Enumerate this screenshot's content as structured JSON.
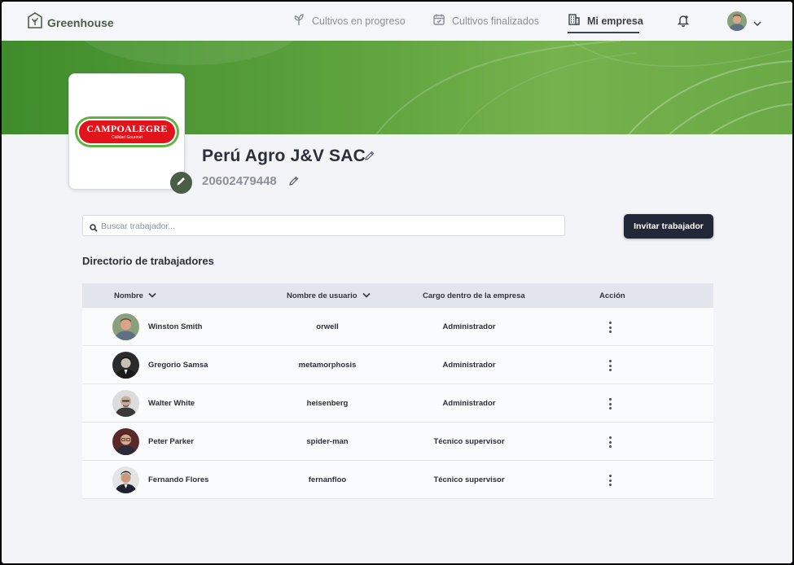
{
  "app": {
    "name": "Greenhouse"
  },
  "nav": {
    "items": [
      {
        "label": "Cultivos en progreso",
        "icon": "sprout-icon"
      },
      {
        "label": "Cultivos finalizados",
        "icon": "calendar-check-icon"
      },
      {
        "label": "Mi empresa",
        "icon": "building-icon",
        "active": true
      }
    ]
  },
  "company": {
    "logo_text": "CAMPOALEGRE",
    "logo_subtext": "Calidad Gourmet",
    "name": "Perú Agro J&V SAC",
    "ruc": "20602479448"
  },
  "search": {
    "placeholder": "Buscar trabajador..."
  },
  "invite_label": "Invitar trabajador",
  "directory": {
    "title": "Directorio de trabajadores",
    "columns": [
      "Nombre",
      "Nombre de usuario",
      "Cargo dentro de la empresa",
      "Acción"
    ],
    "rows": [
      {
        "name": "Winston Smith",
        "username": "orwell",
        "role": "Administrador"
      },
      {
        "name": "Gregorio Samsa",
        "username": "metamorphosis",
        "role": "Administrador"
      },
      {
        "name": "Walter White",
        "username": "heisenberg",
        "role": "Administrador"
      },
      {
        "name": "Peter Parker",
        "username": "spider-man",
        "role": "Técnico supervisor"
      },
      {
        "name": "Fernando Flores",
        "username": "fernanfloo",
        "role": "Técnico supervisor"
      }
    ]
  },
  "colors": {
    "accent": "#4a5e45",
    "banner": "#5ea33e",
    "button": "#232838",
    "logo_red": "#e1141c"
  }
}
